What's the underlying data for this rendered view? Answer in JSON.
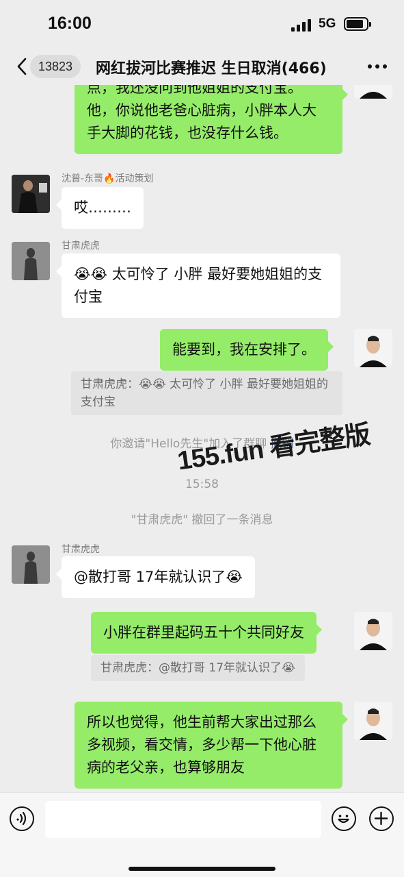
{
  "status_bar": {
    "time": "16:00",
    "network": "5G"
  },
  "nav": {
    "unread_count": "13823",
    "title": "网红拔河比赛推迟 生日取消(466)"
  },
  "messages": {
    "m1_text": "点，我还没问到他姐姐的支付宝。他，你说他老爸心脏病，小胖本人大手大脚的花钱，也没存什么钱。",
    "m2_sender": "沈普-东哥🔥活动策划",
    "m2_text": "哎………",
    "m3_sender": "甘肃虎虎",
    "m3_text": "😭😭 太可怜了  小胖  最好要她姐姐的支付宝",
    "m4_text": "能要到，我在安排了。",
    "m4_quote": "甘肃虎虎：😭😭 太可怜了  小胖  最好要她姐姐的支付宝",
    "sys_invite_prefix": "你邀请\"Hello先生\"加入了群聊",
    "sys_invite_action": "撤销",
    "sys_time": "15:58",
    "sys_recall": "\"甘肃虎虎\" 撤回了一条消息",
    "m5_sender": "甘肃虎虎",
    "m5_text": "@散打哥 17年就认识了😭",
    "m6_text": "小胖在群里起码五十个共同好友",
    "m6_quote": "甘肃虎虎：@散打哥 17年就认识了😭",
    "m7_text": "所以也觉得，他生前帮大家出过那么多视频，看交情，多少帮一下他心脏病的老父亲，也算够朋友"
  },
  "watermark": "155.fun 看完整版",
  "icons": {
    "back": "chevron-left-icon",
    "more": "more-dots-icon",
    "voice": "voice-icon",
    "emoji": "emoji-icon",
    "plus": "plus-icon"
  },
  "colors": {
    "sent_bubble": "#95ec69",
    "received_bubble": "#ffffff",
    "background": "#ededed",
    "link": "#576b95"
  }
}
